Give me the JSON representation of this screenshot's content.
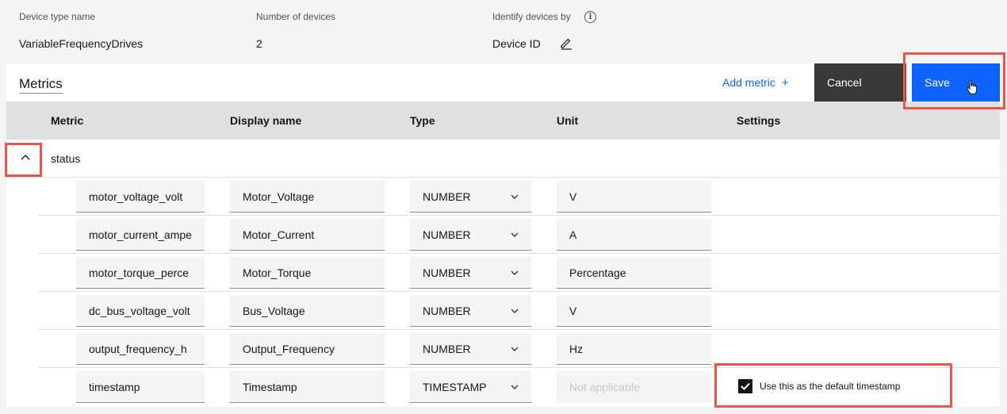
{
  "info": {
    "device_type_label": "Device type name",
    "device_type_value": "VariableFrequencyDrives",
    "num_devices_label": "Number of devices",
    "num_devices_value": "2",
    "identify_label": "Identify devices by",
    "identify_value": "Device ID"
  },
  "toolbar": {
    "title": "Metrics",
    "add_metric_label": "Add metric",
    "add_icon": "+",
    "cancel_label": "Cancel",
    "save_label": "Save"
  },
  "table": {
    "headers": [
      "Metric",
      "Display name",
      "Type",
      "Unit",
      "Settings"
    ],
    "group": "status",
    "rows": [
      {
        "metric": "motor_voltage_volt",
        "display": "Motor_Voltage",
        "type": "NUMBER",
        "unit": "V",
        "unit_placeholder": ""
      },
      {
        "metric": "motor_current_ampe",
        "display": "Motor_Current",
        "type": "NUMBER",
        "unit": "A",
        "unit_placeholder": ""
      },
      {
        "metric": "motor_torque_perce",
        "display": "Motor_Torque",
        "type": "NUMBER",
        "unit": "Percentage",
        "unit_placeholder": ""
      },
      {
        "metric": "dc_bus_voltage_volt",
        "display": "Bus_Voltage",
        "type": "NUMBER",
        "unit": "V",
        "unit_placeholder": ""
      },
      {
        "metric": "output_frequency_h",
        "display": "Output_Frequency",
        "type": "NUMBER",
        "unit": "Hz",
        "unit_placeholder": ""
      },
      {
        "metric": "timestamp",
        "display": "Timestamp",
        "type": "TIMESTAMP",
        "unit": "",
        "unit_placeholder": "Not applicable"
      }
    ],
    "default_timestamp_label": "Use this as the default timestamp"
  },
  "colors": {
    "accent": "#0f62fe",
    "highlight": "#e8574e",
    "cancel_bg": "#393939"
  },
  "icons": [
    "info-icon",
    "edit-icon",
    "chevron-up-icon",
    "chevron-down-icon",
    "checkbox-checked-icon",
    "hand-pointer-icon"
  ]
}
